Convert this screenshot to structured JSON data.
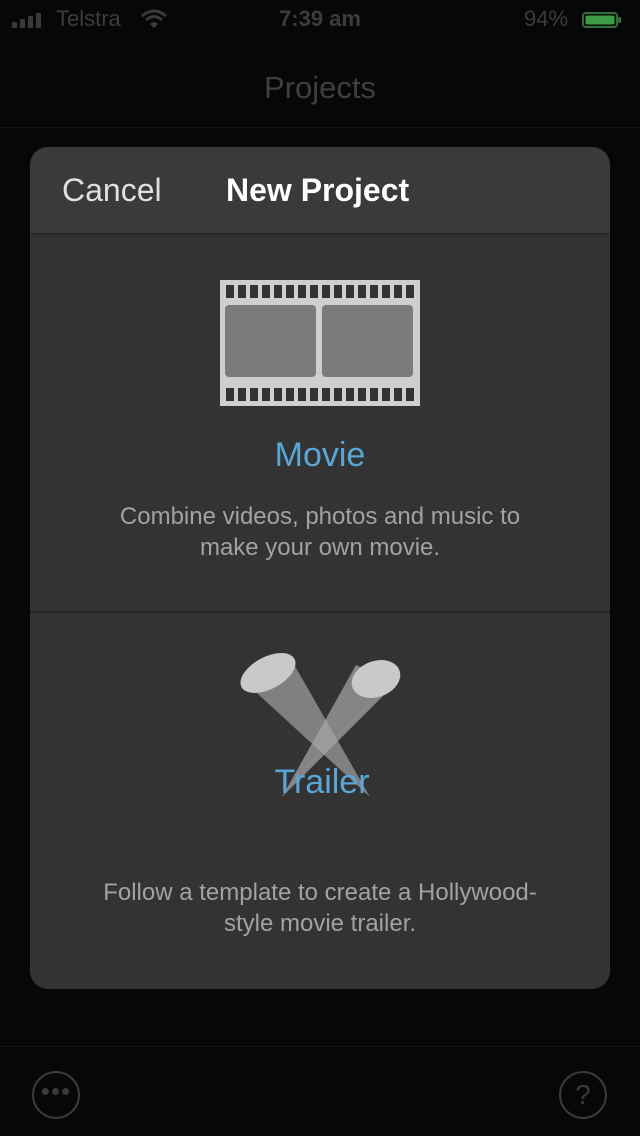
{
  "status_bar": {
    "carrier": "Telstra",
    "time": "7:39 am",
    "battery_percent": "94%",
    "battery_color": "#4cd964"
  },
  "nav": {
    "title": "Projects"
  },
  "bottom_bar": {
    "more_label": "•••",
    "help_label": "?"
  },
  "sheet": {
    "cancel_label": "Cancel",
    "title": "New Project",
    "options": [
      {
        "icon": "film-strip-icon",
        "label": "Movie",
        "description": "Combine videos, photos and music to make your own movie."
      },
      {
        "icon": "spotlights-icon",
        "label": "Trailer",
        "description": "Follow a template to create a Hollywood-style movie trailer."
      }
    ]
  },
  "colors": {
    "accent": "#5aa6d6",
    "sheet_background": "#333333"
  }
}
